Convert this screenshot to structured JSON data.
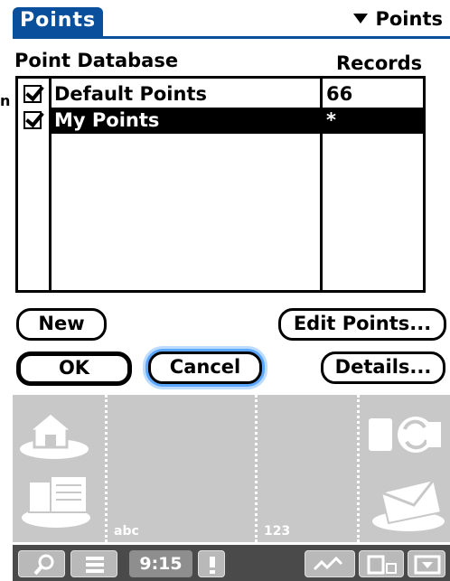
{
  "stray_char": "n",
  "title": "Points",
  "category": {
    "selected": "Points"
  },
  "table": {
    "headers": {
      "name": "Point Database",
      "records": "Records"
    },
    "rows": [
      {
        "checked": true,
        "name": "Default Points",
        "records": "66",
        "selected": false
      },
      {
        "checked": true,
        "name": "My Points",
        "records": "*",
        "selected": true
      }
    ]
  },
  "buttons": {
    "new": "New",
    "edit_points": "Edit Points...",
    "ok": "OK",
    "cancel": "Cancel",
    "details": "Details..."
  },
  "graffiti": {
    "abc_label": "abc",
    "num_label": "123",
    "icons": [
      "home-icon",
      "calendar-apps-icon",
      "sync-icon",
      "mail-icon"
    ]
  },
  "statusbar": {
    "time": "9:15",
    "icons": [
      "find-icon",
      "menu-icon",
      "alert-icon",
      "signal-icon",
      "connection-icon",
      "input-icon"
    ]
  },
  "colors": {
    "title_blue": "#0a4f9c",
    "focus_ring": "#5ba7ff",
    "graffiti_bg": "#c8c8c8",
    "status_bg": "#4a4a4a"
  }
}
